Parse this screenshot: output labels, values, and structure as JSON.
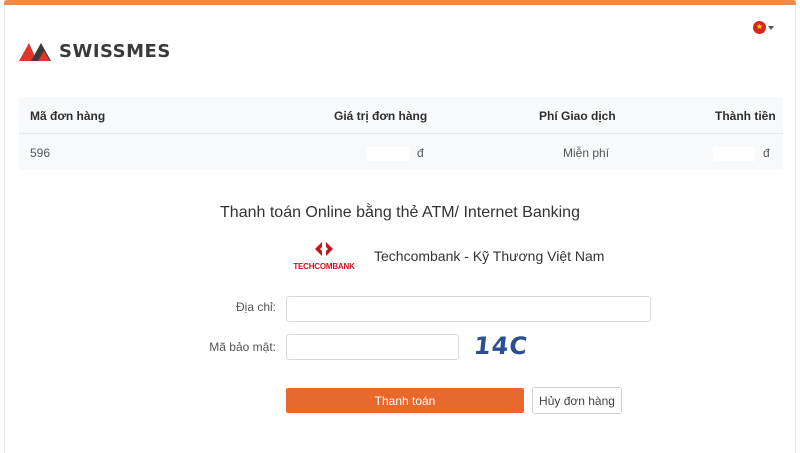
{
  "brand": {
    "name": "SWISSMES",
    "logo_icon": "swissmes-logo-icon",
    "accent_color": "#e8692e"
  },
  "language": {
    "flag_icon": "vietnam-flag-icon",
    "flag_star": "★"
  },
  "order": {
    "headers": [
      "Mã đơn hàng",
      "Giá trị đơn hàng",
      "Phí Giao dịch",
      "Thành tiền"
    ],
    "row": {
      "order_id": "596",
      "order_value_currency": "đ",
      "fee": "Miễn phí",
      "total_currency": "đ"
    }
  },
  "payment": {
    "title": "Thanh toán Online bằng thẻ ATM/ Internet Banking",
    "bank_logo_text": "TECHCOMBANK",
    "bank_name": "Techcombank - Kỹ Thương Việt Nam",
    "address_label": "Địa chỉ:",
    "address_value": "",
    "security_label": "Mã bảo mật:",
    "security_value": "",
    "captcha": "14C",
    "pay_button": "Thanh toán",
    "cancel_button": "Hủy đơn hàng"
  }
}
